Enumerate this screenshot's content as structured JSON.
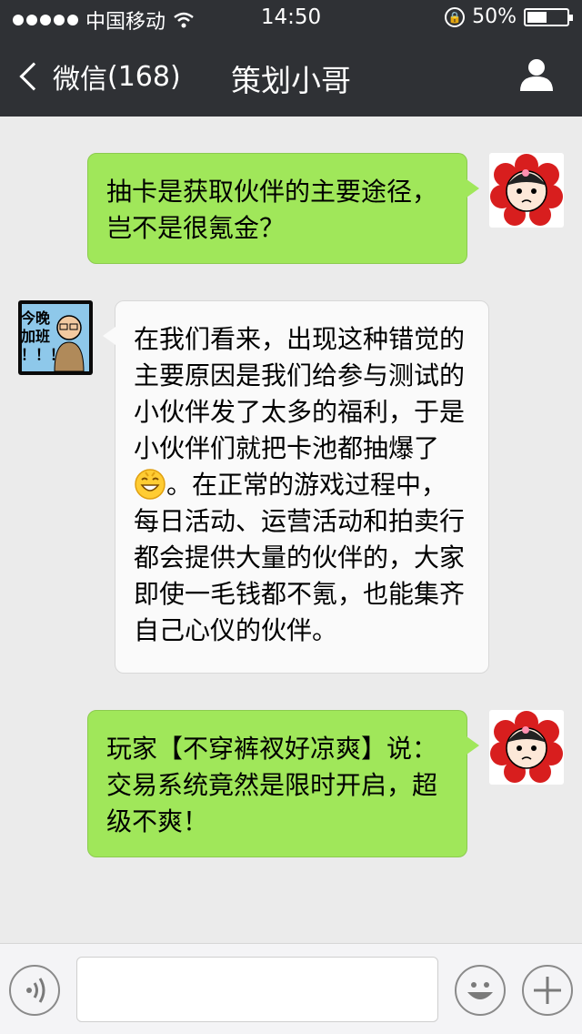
{
  "status_bar": {
    "carrier": "中国移动",
    "time": "14:50",
    "battery": "50%",
    "battery_level": 0.5
  },
  "nav": {
    "back_label": "微信",
    "back_count": "(168)",
    "title": "策划小哥"
  },
  "messages": [
    {
      "sender": "me",
      "text": "抽卡是获取伙伴的主要途径，\n岂不是很氪金？"
    },
    {
      "sender": "other",
      "avatar_text": [
        "今晚",
        "加班",
        "！！！"
      ],
      "text_before": "在我们看来，出现这种错觉的\n主要原因是我们给参与测试的\n小伙伴发了太多的福利，于是\n小伙伴们就把卡池都抽爆了\n",
      "emoji": "grin-emoji",
      "text_after": "。在正常的游戏过程中，\n每日活动、运营活动和拍卖行\n都会提供大量的伙伴的，大家\n即使一毛钱都不氪，也能集齐\n自己心仪的伙伴。"
    },
    {
      "sender": "me",
      "text": "玩家【不穿裤衩好凉爽】说：\n交易系统竟然是限时开启，超\n级不爽！"
    }
  ],
  "colors": {
    "topbar": "#2f3135",
    "my_bubble": "#a0e75a",
    "other_bubble": "#fafafa",
    "background": "#ebebeb"
  }
}
